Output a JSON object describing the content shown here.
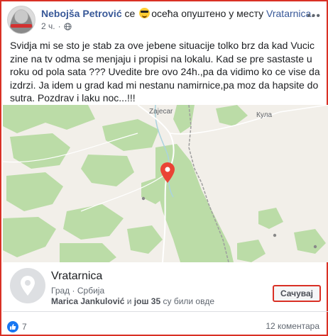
{
  "post": {
    "author": "Nebojša Petrović",
    "feeling_prefix": "се",
    "feeling_text": "осећа опуштено у месту",
    "location": "Vratarnica",
    "location_suffix": ".",
    "time": "2 ч.",
    "privacy_icon": "globe-icon",
    "more_icon": "ellipsis-icon",
    "text": "Svidja mi se sto je stab za ove jebene situacije tolko brz da kad Vucic zine na tv odma se menjaju i propisi na lokalu. Kad se pre sastaste u roku od pola sata ??? Uvedite bre ovo 24h.,pa da vidimo ko ce vise da izdrzi. Ja idem u grad kad mi nestanu namirnice,pa moz da hapsite do sutra. Pozdrav i laku noc...!!!"
  },
  "map": {
    "labels": {
      "zajecar": "Zajecar",
      "kula": "Кула"
    },
    "colors": {
      "land": "#f2efe9",
      "forest": "#b9dca4",
      "river": "#aad3df",
      "road": "#ffffff",
      "pin": "#ea4335"
    }
  },
  "place": {
    "name": "Vratarnica",
    "category": "Град",
    "country": "Србија",
    "separator": "·",
    "friend_name": "Marica Jankulović",
    "friend_connector": "и",
    "others": "још 35",
    "friends_suffix": "су били овде",
    "save_label": "Сачувај"
  },
  "footer": {
    "like_count": "7",
    "comments": "12 коментара"
  },
  "accent": {
    "link": "#385898",
    "highlight_border": "#d93025",
    "like_blue": "#1877f2"
  }
}
